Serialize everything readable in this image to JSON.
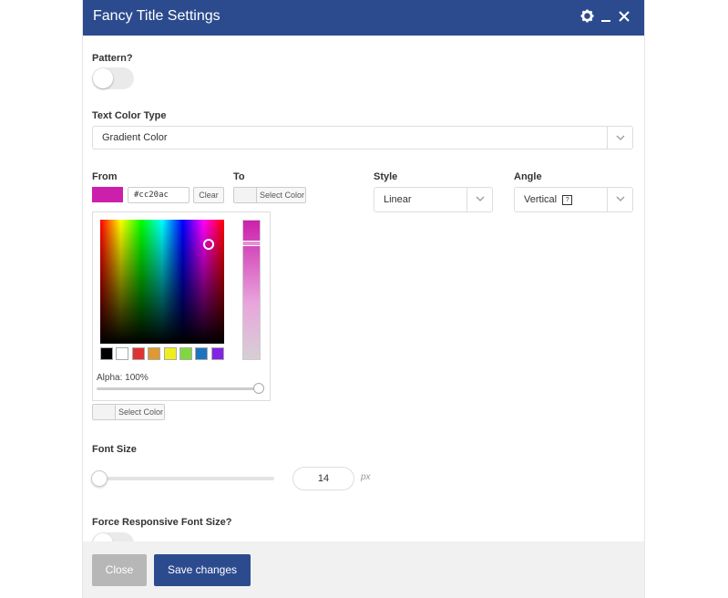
{
  "header": {
    "title": "Fancy Title Settings",
    "icons": [
      "gear-icon",
      "minimize-icon",
      "close-icon"
    ]
  },
  "pattern": {
    "label": "Pattern?",
    "enabled": false
  },
  "text_color_type": {
    "label": "Text Color Type",
    "value": "Gradient Color"
  },
  "from": {
    "label": "From",
    "color": "#cc20ac",
    "hex_value": "#cc20ac",
    "clear_label": "Clear"
  },
  "to": {
    "label": "To",
    "select_label": "Select Color"
  },
  "style": {
    "label": "Style",
    "value": "Linear"
  },
  "angle": {
    "label": "Angle",
    "value": "Vertical",
    "help": "?"
  },
  "picker": {
    "alpha_label": "Alpha: 100%",
    "presets": [
      "#000000",
      "#ffffff",
      "#dd3333",
      "#dd9933",
      "#eeee22",
      "#81d742",
      "#1e73be",
      "#8224e3"
    ],
    "select_label": "Select Color"
  },
  "font_size": {
    "label": "Font Size",
    "value": "14",
    "unit": "px"
  },
  "force_responsive": {
    "label": "Force Responsive Font Size?"
  },
  "footer": {
    "close_label": "Close",
    "save_label": "Save changes"
  }
}
